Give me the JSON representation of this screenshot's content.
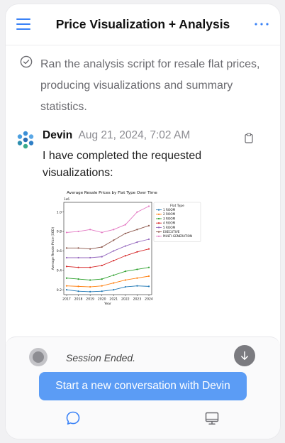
{
  "header": {
    "title": "Price Visualization + Analysis",
    "menu_icon": "hamburger-menu-icon",
    "more_icon": "more-horizontal-icon"
  },
  "status": {
    "icon": "check-circle-icon",
    "text": "Ran the analysis script for resale flat prices, producing visualizations and summary statistics."
  },
  "message": {
    "author": "Devin",
    "timestamp": "Aug 21, 2024, 7:02 AM",
    "body": "I have completed the requested visualizations:",
    "avatar_icon": "devin-logo-icon",
    "copy_icon": "clipboard-icon"
  },
  "chart_data": {
    "type": "line",
    "title": "Average Resale Prices by Flat Type Over Time",
    "xlabel": "Year",
    "ylabel": "Average Resale Price (SGD)",
    "scale_note": "1e6",
    "x": [
      2017,
      2018,
      2019,
      2020,
      2021,
      2022,
      2023,
      2024
    ],
    "ylim": [
      0.15,
      1.1
    ],
    "yticks": [
      0.2,
      0.4,
      0.6,
      0.8,
      1.0
    ],
    "legend_title": "Flat Type",
    "series": [
      {
        "name": "1 ROOM",
        "color": "#1f77b4",
        "values": [
          0.2,
          0.185,
          0.18,
          0.185,
          0.2,
          0.23,
          0.24,
          0.235
        ]
      },
      {
        "name": "2 ROOM",
        "color": "#ff7f0e",
        "values": [
          0.24,
          0.235,
          0.23,
          0.24,
          0.27,
          0.3,
          0.32,
          0.34
        ]
      },
      {
        "name": "3 ROOM",
        "color": "#2ca02c",
        "values": [
          0.32,
          0.31,
          0.3,
          0.31,
          0.35,
          0.39,
          0.41,
          0.43
        ]
      },
      {
        "name": "4 ROOM",
        "color": "#d62728",
        "values": [
          0.44,
          0.43,
          0.43,
          0.45,
          0.5,
          0.55,
          0.59,
          0.62
        ]
      },
      {
        "name": "5 ROOM",
        "color": "#9467bd",
        "values": [
          0.53,
          0.53,
          0.53,
          0.54,
          0.6,
          0.65,
          0.69,
          0.72
        ]
      },
      {
        "name": "EXECUTIVE",
        "color": "#8c564b",
        "values": [
          0.63,
          0.63,
          0.62,
          0.64,
          0.71,
          0.78,
          0.82,
          0.86
        ]
      },
      {
        "name": "MULTI-GENERATION",
        "color": "#e377c2",
        "values": [
          0.79,
          0.8,
          0.82,
          0.79,
          0.82,
          0.87,
          1.0,
          1.06
        ]
      }
    ]
  },
  "panel": {
    "session_text": "Session Ended.",
    "scroll_icon": "arrow-down-icon",
    "new_conversation_label": "Start a new conversation with Devin",
    "nav_chat_icon": "chat-bubble-icon",
    "nav_desktop_icon": "desktop-monitor-icon"
  }
}
